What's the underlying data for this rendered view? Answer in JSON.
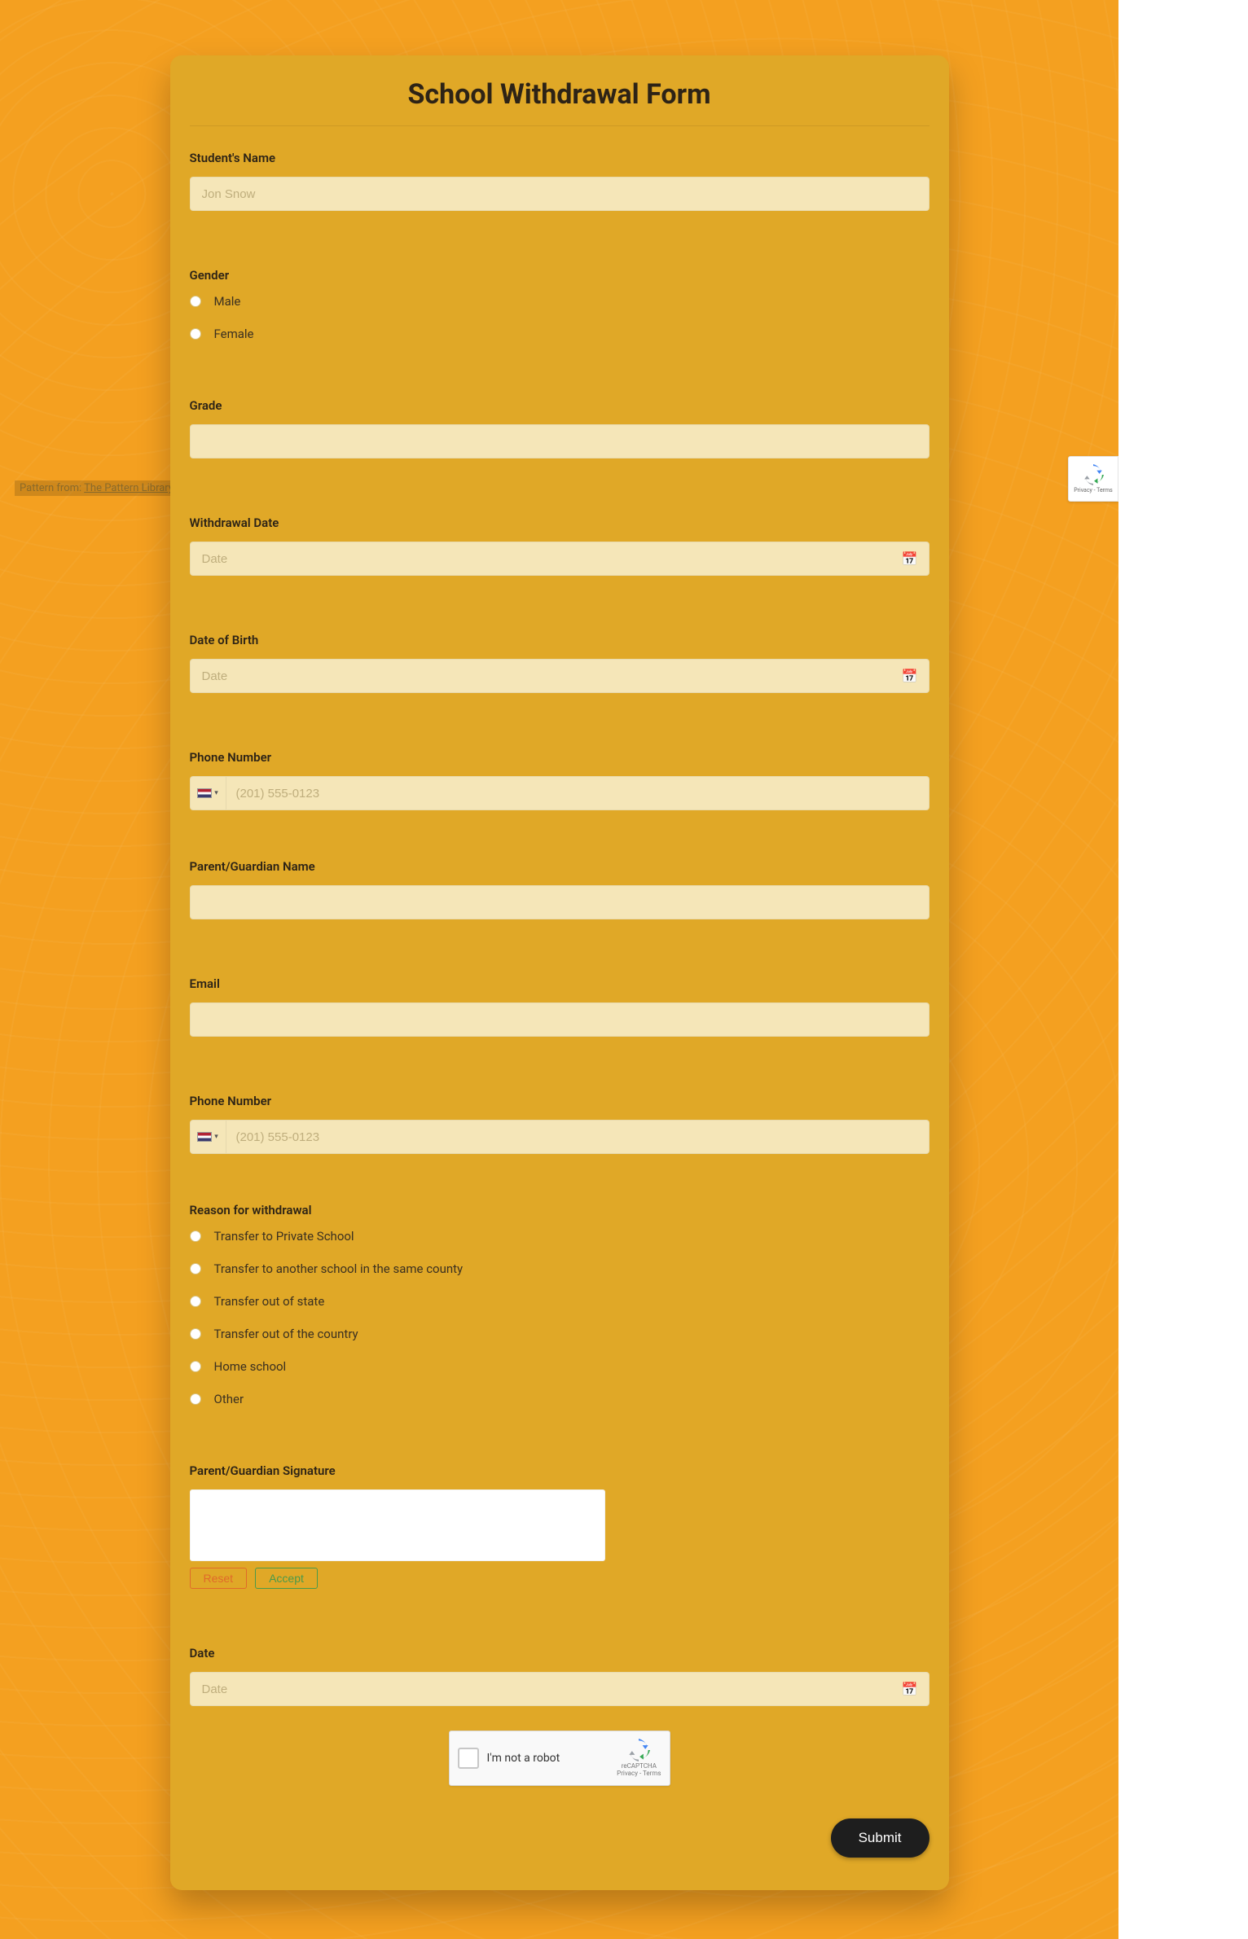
{
  "credit": {
    "prefix": "Pattern from: ",
    "link": "The Pattern Library"
  },
  "title": "School Withdrawal Form",
  "fields": {
    "student_name": {
      "label": "Student's Name",
      "placeholder": "Jon Snow"
    },
    "gender": {
      "label": "Gender",
      "options": [
        "Male",
        "Female"
      ]
    },
    "grade": {
      "label": "Grade"
    },
    "withdrawal_date": {
      "label": "Withdrawal Date",
      "placeholder": "Date"
    },
    "dob": {
      "label": "Date of Birth",
      "placeholder": "Date"
    },
    "phone1": {
      "label": "Phone Number",
      "placeholder": "(201) 555-0123"
    },
    "parent_name": {
      "label": "Parent/Guardian Name"
    },
    "email": {
      "label": "Email"
    },
    "phone2": {
      "label": "Phone Number",
      "placeholder": "(201) 555-0123"
    },
    "reason": {
      "label": "Reason for withdrawal",
      "options": [
        "Transfer to Private School",
        "Transfer to another school in the same county",
        "Transfer out of state",
        "Transfer out of the country",
        "Home school",
        "Other"
      ]
    },
    "signature": {
      "label": "Parent/Guardian Signature",
      "reset": "Reset",
      "accept": "Accept"
    },
    "date": {
      "label": "Date",
      "placeholder": "Date"
    }
  },
  "captcha": {
    "label": "I'm not a robot",
    "brand": "reCAPTCHA",
    "terms": "Privacy - Terms"
  },
  "submit": "Submit"
}
